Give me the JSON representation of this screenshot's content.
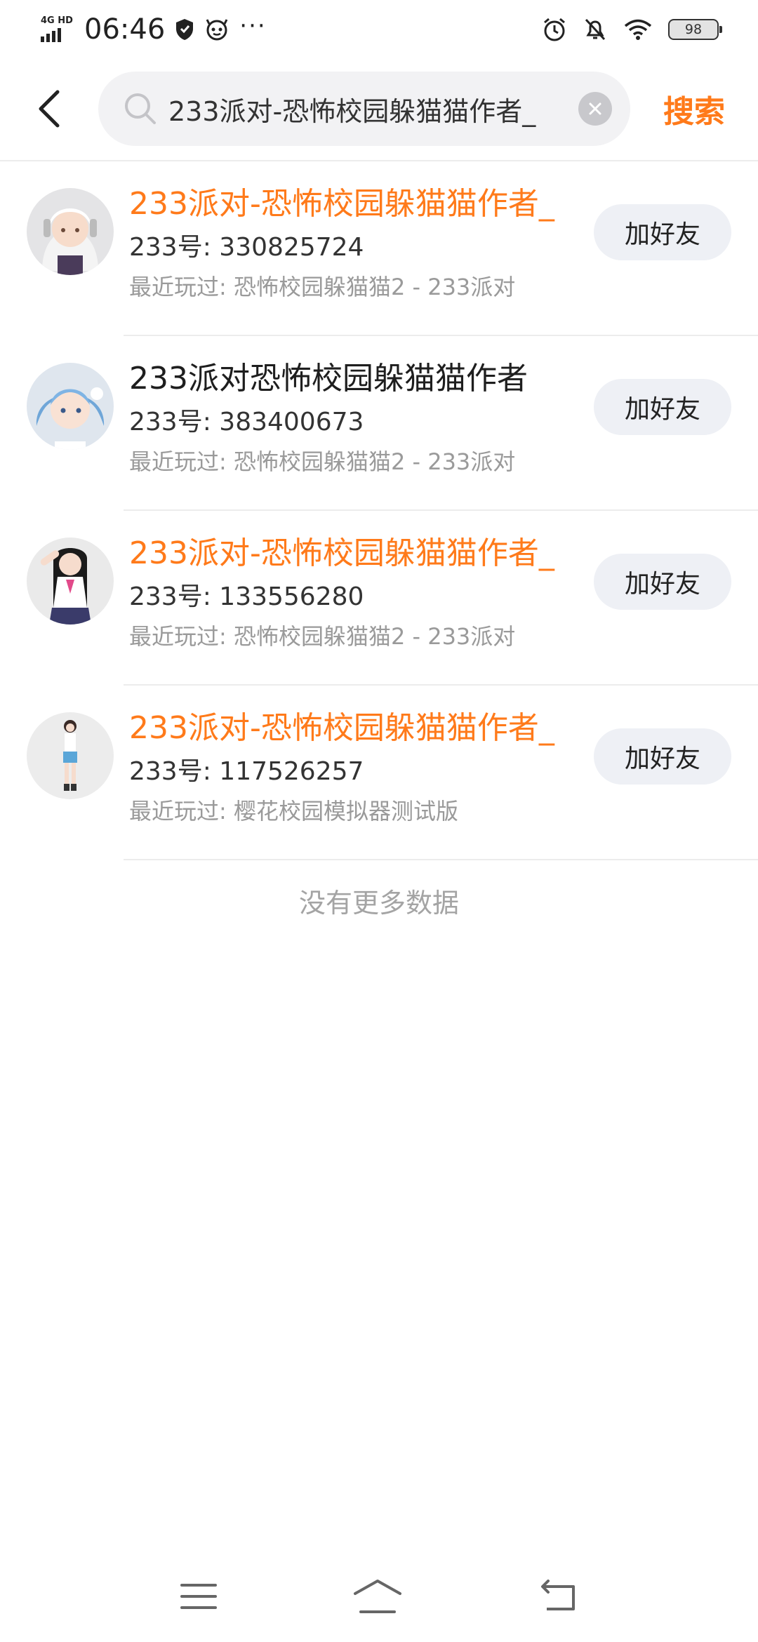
{
  "status_bar": {
    "network": "4G HD",
    "time": "06:46",
    "more": "···",
    "battery": "98"
  },
  "search": {
    "value": "233派对-恐怖校园躲猫猫作者_",
    "submit_label": "搜索"
  },
  "results": [
    {
      "name": "233派对-恐怖校园躲猫猫作者_",
      "id_label": "233号: 330825724",
      "played_label": "最近玩过: 恐怖校园躲猫猫2 - 233派对",
      "add_label": "加好友",
      "highlight": true
    },
    {
      "name": "233派对恐怖校园躲猫猫作者",
      "id_label": "233号: 383400673",
      "played_label": "最近玩过: 恐怖校园躲猫猫2 - 233派对",
      "add_label": "加好友",
      "highlight": false
    },
    {
      "name": "233派对-恐怖校园躲猫猫作者_",
      "id_label": "233号: 133556280",
      "played_label": "最近玩过: 恐怖校园躲猫猫2 - 233派对",
      "add_label": "加好友",
      "highlight": true
    },
    {
      "name": "233派对-恐怖校园躲猫猫作者_",
      "id_label": "233号: 117526257",
      "played_label": "最近玩过: 樱花校园模拟器测试版",
      "add_label": "加好友",
      "highlight": true
    }
  ],
  "footer": {
    "no_more": "没有更多数据"
  },
  "colors": {
    "accent": "#ff7a1a",
    "button_bg": "#eef0f5",
    "search_bg": "#f2f2f4"
  },
  "icons": {
    "back": "chevron-left-icon",
    "search": "search-icon",
    "clear": "close-circle-icon",
    "nav_menu": "menu-icon",
    "nav_home": "home-icon",
    "nav_back": "back-arrow-icon"
  }
}
